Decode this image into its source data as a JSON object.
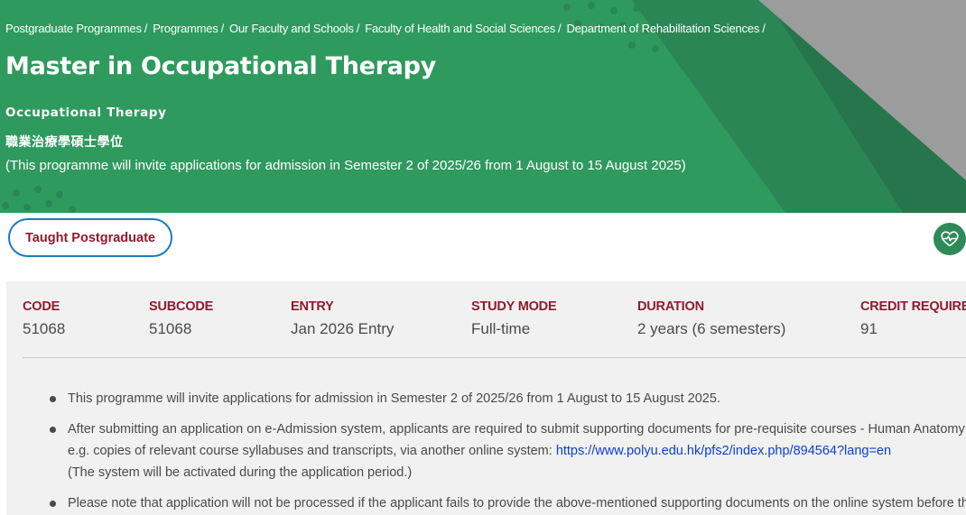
{
  "hero": {
    "breadcrumb": [
      {
        "label": "Postgraduate Programmes"
      },
      {
        "label": "Programmes"
      },
      {
        "label": "Our Faculty and Schools"
      },
      {
        "label": "Faculty of Health and Social Sciences"
      },
      {
        "label": "Department of Rehabilitation Sciences"
      }
    ],
    "breadcrumb_separator": "/",
    "title": "Master in Occupational Therapy",
    "subtitle": "Occupational Therapy",
    "chinese_title": "職業治療學碩士學位",
    "note": "(This programme will invite applications for admission in Semester 2 of 2025/26 from 1 August to 15 August 2025)"
  },
  "tag": {
    "label": "Taught Postgraduate"
  },
  "badge": {
    "icon": "heart-pulse-icon"
  },
  "info": {
    "columns": [
      {
        "label": "CODE",
        "value": "51068"
      },
      {
        "label": "SUBCODE",
        "value": "51068"
      },
      {
        "label": "ENTRY",
        "value": "Jan 2026 Entry"
      },
      {
        "label": "STUDY MODE",
        "value": "Full-time"
      },
      {
        "label": "DURATION",
        "value": "2 years (6 semesters)"
      },
      {
        "label": "CREDIT REQUIRED",
        "value": "91"
      }
    ]
  },
  "notes": {
    "items": [
      {
        "text": "This programme will invite applications for admission in Semester 2 of 2025/26 from 1 August to 15 August 2025."
      },
      {
        "line1": "After submitting an application on e-Admission system, applicants are required to submit supporting documents for pre-requisite courses - Human Anatomy",
        "line2_text": "e.g. copies of relevant course syllabuses and transcripts, via another online system: ",
        "link": "https://www.polyu.edu.hk/pfs2/index.php/894564?lang=en",
        "line3": "(The system will be activated during the application period.)"
      },
      {
        "text": "Please note that application will not be processed if the applicant fails to provide the above-mentioned supporting documents on the online system before the deadline."
      }
    ]
  },
  "colors": {
    "hero_green": "#2f9a5e",
    "label_maroon": "#8f1b30",
    "tag_border_blue": "#1c7ac0",
    "badge_green": "#2e8a57",
    "panel_gray": "#f1f1f1",
    "link_blue": "#0b3fd1"
  }
}
